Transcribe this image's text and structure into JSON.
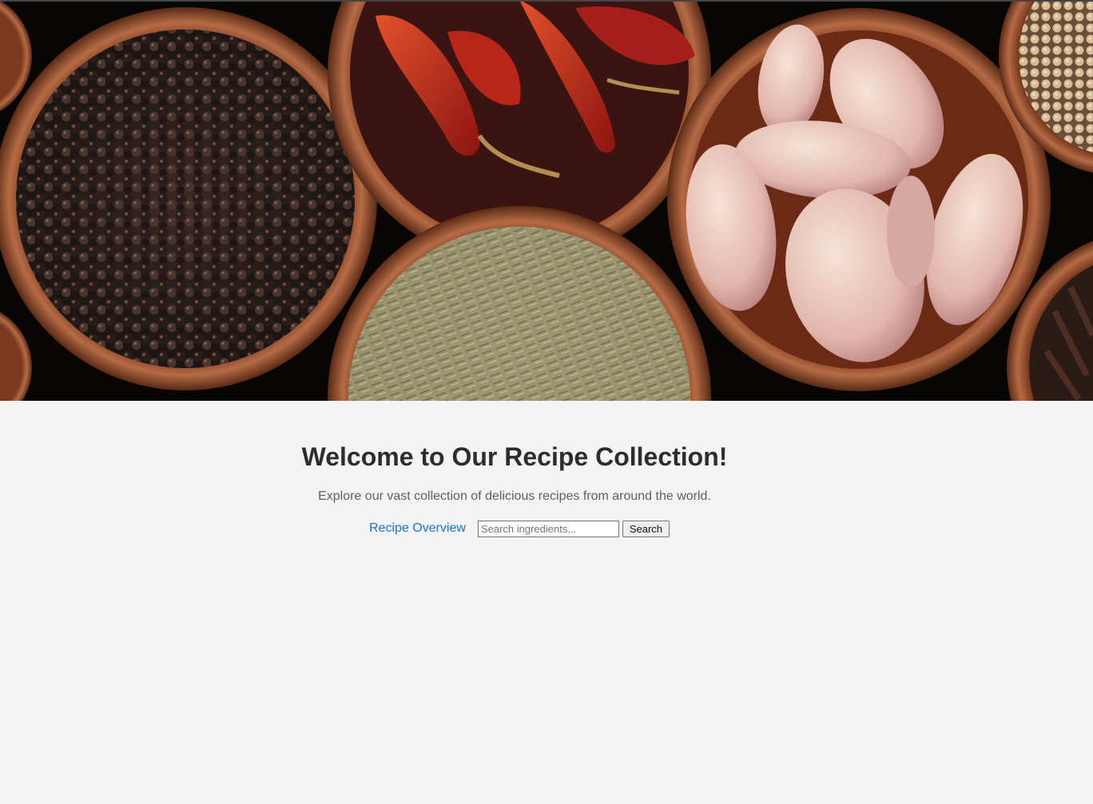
{
  "hero": {
    "image_name": "spice-bowls-banner",
    "icon": "hero-image"
  },
  "main": {
    "title": "Welcome to Our Recipe Collection!",
    "subtitle": "Explore our vast collection of delicious recipes from around the world.",
    "overview_link": "Recipe Overview",
    "search": {
      "placeholder": "Search ingredients...",
      "value": "",
      "button_label": "Search"
    }
  },
  "colors": {
    "background": "#f3f3f3",
    "link": "#1a73d9",
    "title": "#2d2d2d",
    "subtitle": "#5f5f5f"
  }
}
